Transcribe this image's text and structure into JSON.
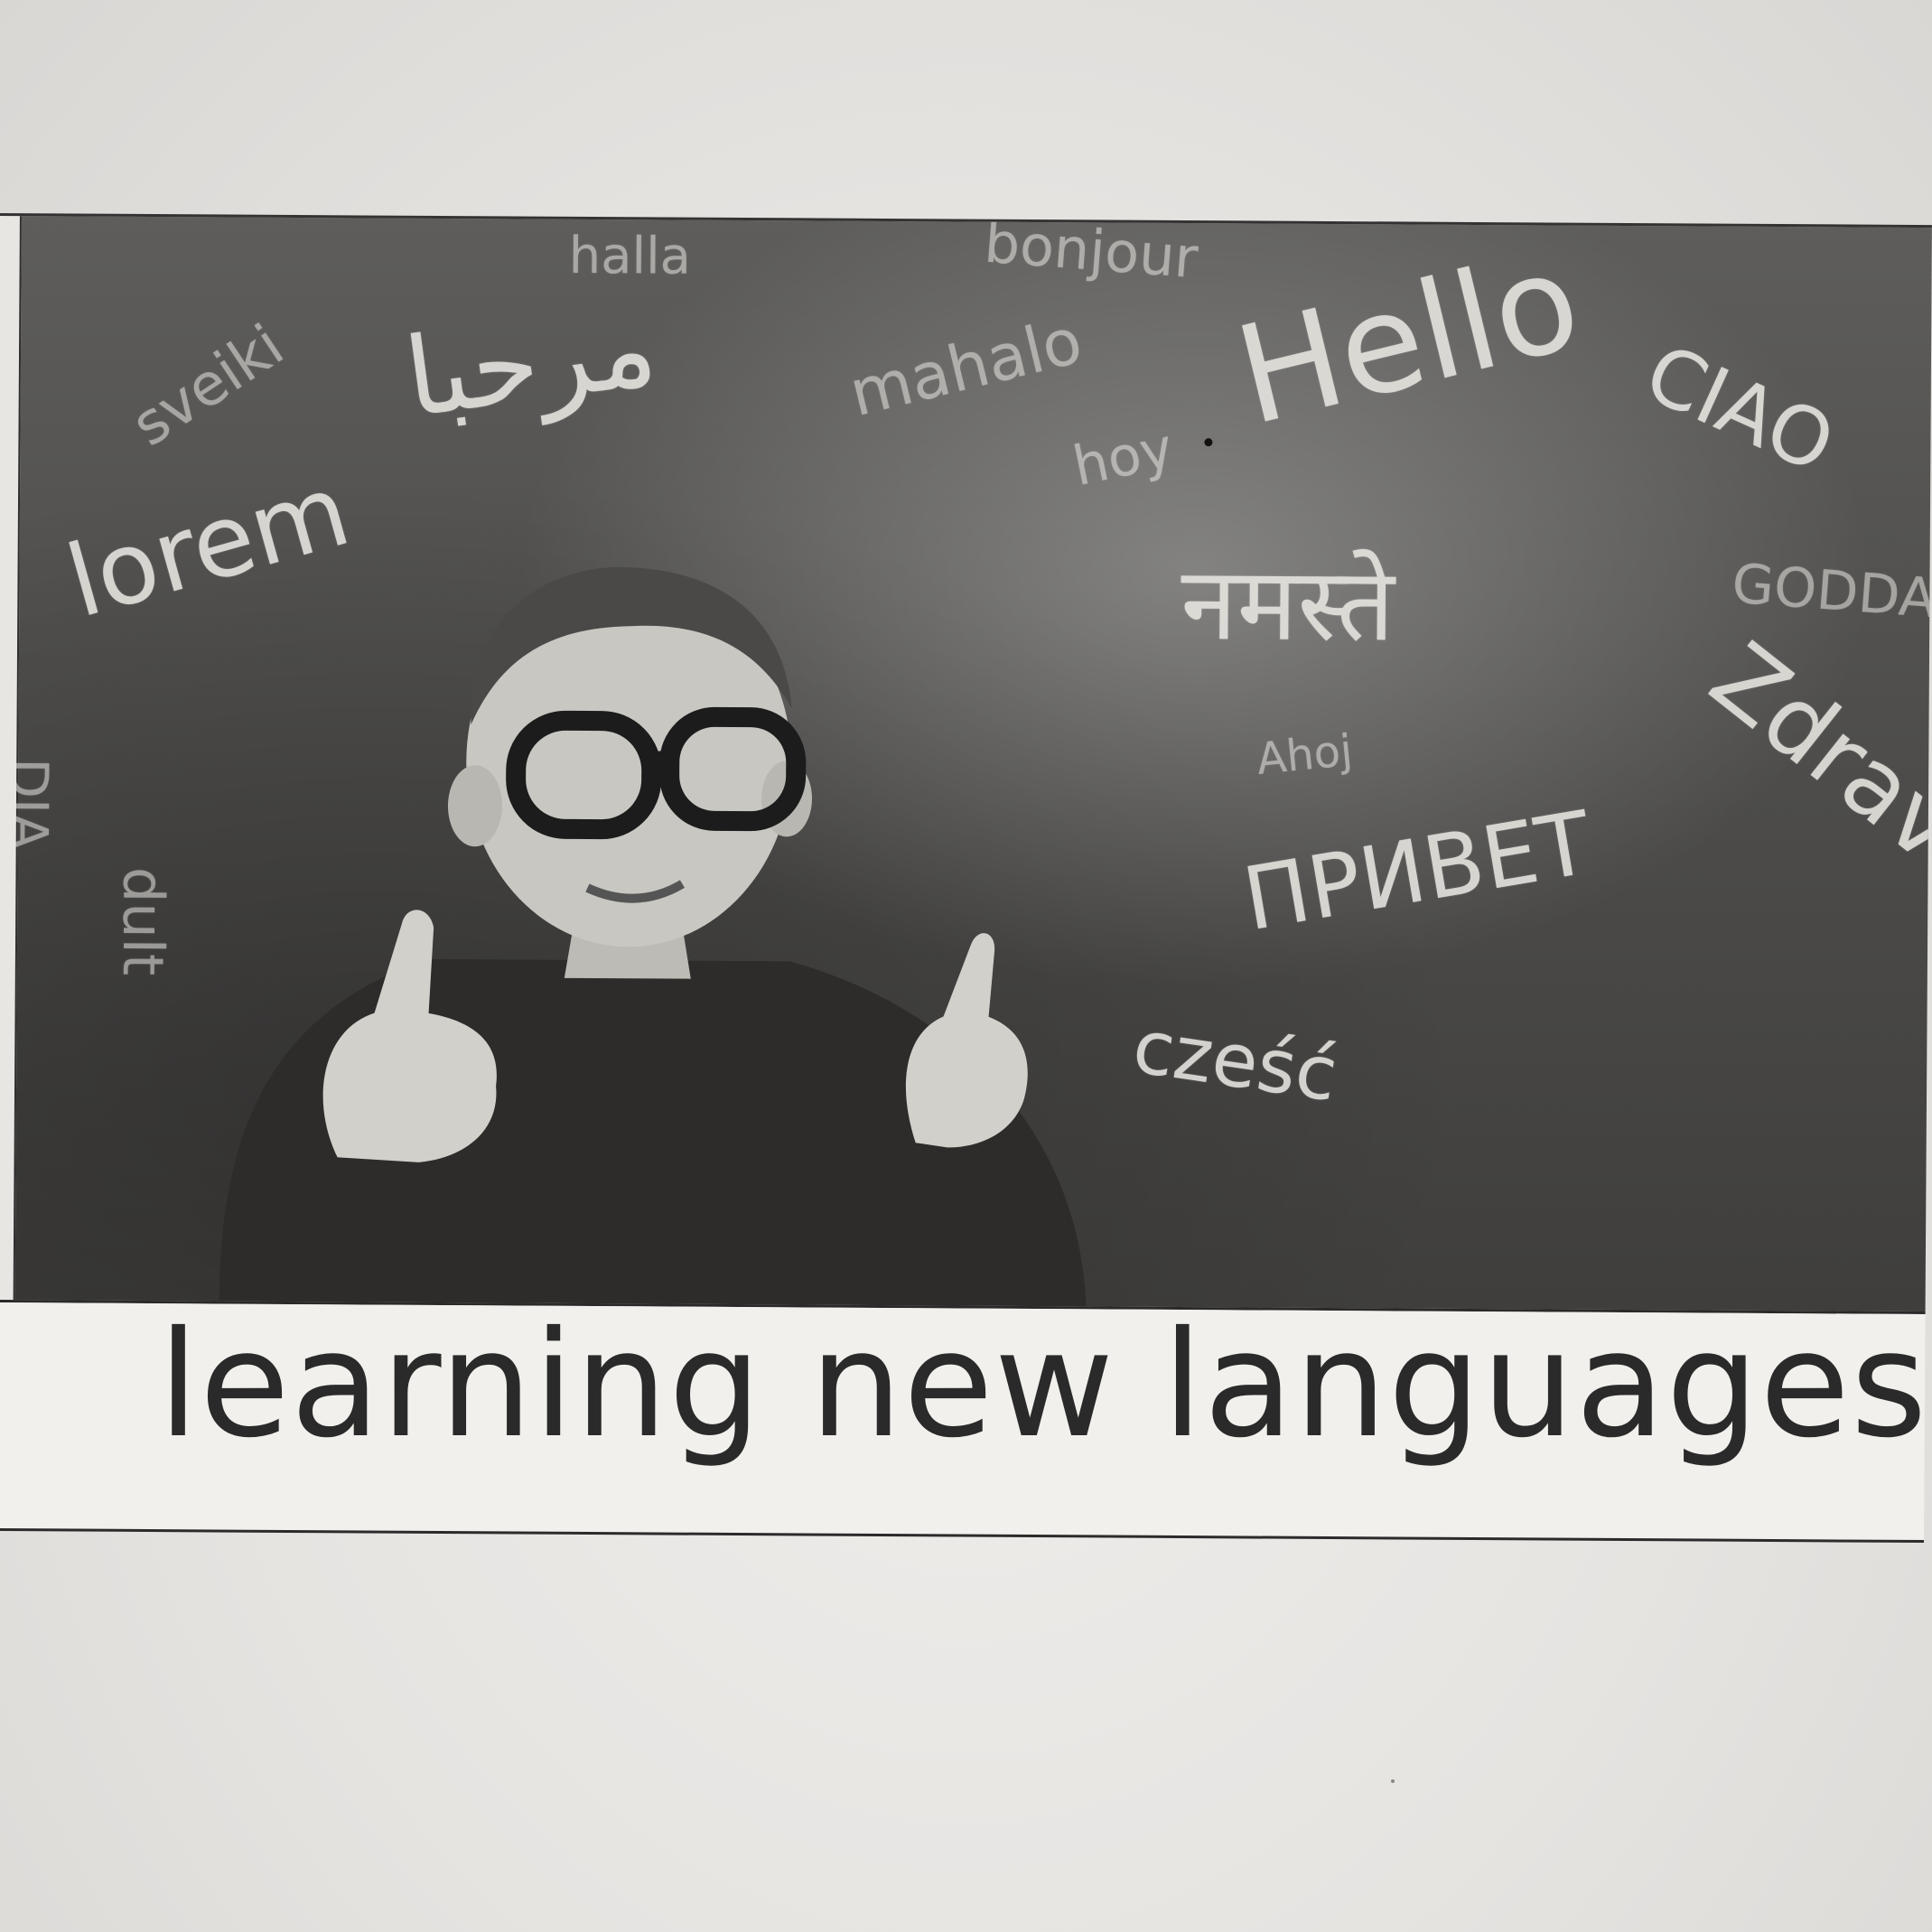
{
  "photo": {
    "description_icon": "child-with-glasses-thumbs-up",
    "chalk_words": [
      "halla",
      "bonjour",
      "Hello",
      "mahalo",
      "hoy",
      "مرحبا",
      "lorem",
      "sveiki",
      "CIAO",
      "नमस्ते",
      "GODDAG",
      "Ahoj",
      "Zdrav",
      "ПРИВЕТ",
      "cześć",
      "DIA",
      "dult"
    ]
  },
  "caption": "learning new languages"
}
